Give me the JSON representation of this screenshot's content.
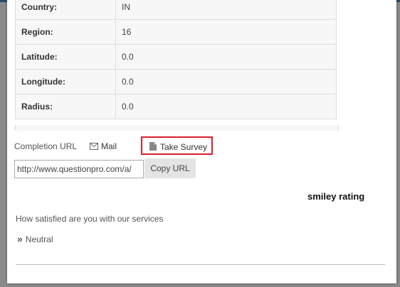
{
  "details": [
    {
      "key": "Country:",
      "value": "IN"
    },
    {
      "key": "Region:",
      "value": "16"
    },
    {
      "key": "Latitude:",
      "value": "0.0"
    },
    {
      "key": "Longitude:",
      "value": "0.0"
    },
    {
      "key": "Radius:",
      "value": "0.0"
    }
  ],
  "share": {
    "completion_label": "Completion URL",
    "mail_label": "Mail",
    "mail_icon": "envelope-icon",
    "take_survey_label": "Take Survey",
    "take_survey_icon": "document-icon",
    "url_value": "http://www.questionpro.com/a/",
    "copy_label": "Copy URL"
  },
  "response": {
    "title": "smiley rating",
    "question": "How satisfied are you with our services",
    "answer_icon": "double-chevron-right-icon",
    "answer": "Neutral"
  },
  "colors": {
    "highlight_border": "#d9202c",
    "topbar": "#2c4a6e",
    "overlay": "#8a8a8a"
  }
}
